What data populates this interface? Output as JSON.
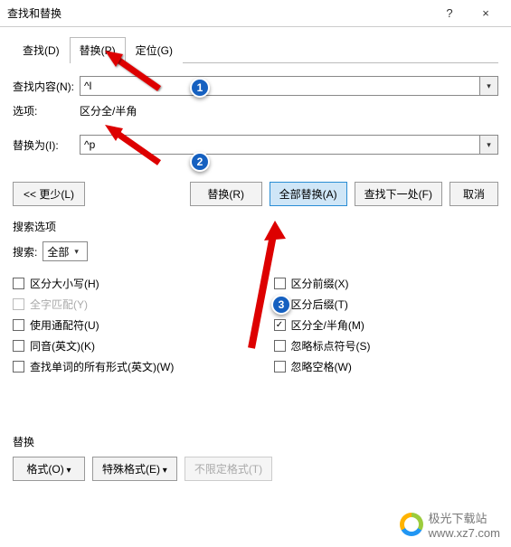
{
  "window": {
    "title": "查找和替换",
    "help": "?",
    "close": "×"
  },
  "tabs": {
    "find": "查找(D)",
    "replace": "替换(P)",
    "goto": "定位(G)"
  },
  "form": {
    "find_label": "查找内容(N):",
    "find_value": "^l",
    "options_label": "选项:",
    "options_value": "区分全/半角",
    "replace_label": "替换为(I):",
    "replace_value": "^p"
  },
  "buttons": {
    "less": "<< 更少(L)",
    "replace": "替换(R)",
    "replace_all": "全部替换(A)",
    "find_next": "查找下一处(F)",
    "cancel": "取消"
  },
  "search_options": {
    "title": "搜索选项",
    "search_label": "搜索:",
    "search_value": "全部",
    "left": {
      "match_case": "区分大小写(H)",
      "whole_word": "全字匹配(Y)",
      "wildcards": "使用通配符(U)",
      "sounds_like": "同音(英文)(K)",
      "all_forms": "查找单词的所有形式(英文)(W)"
    },
    "right": {
      "prefix": "区分前缀(X)",
      "suffix": "区分后缀(T)",
      "full_half": "区分全/半角(M)",
      "punct": "忽略标点符号(S)",
      "space": "忽略空格(W)"
    }
  },
  "replace_section": {
    "title": "替换",
    "format": "格式(O)",
    "special": "特殊格式(E)",
    "no_format": "不限定格式(T)"
  },
  "annotations": {
    "b1": "1",
    "b2": "2",
    "b3": "3"
  },
  "watermark": {
    "line1": "极光下载站",
    "line2": "www.xz7.com"
  }
}
